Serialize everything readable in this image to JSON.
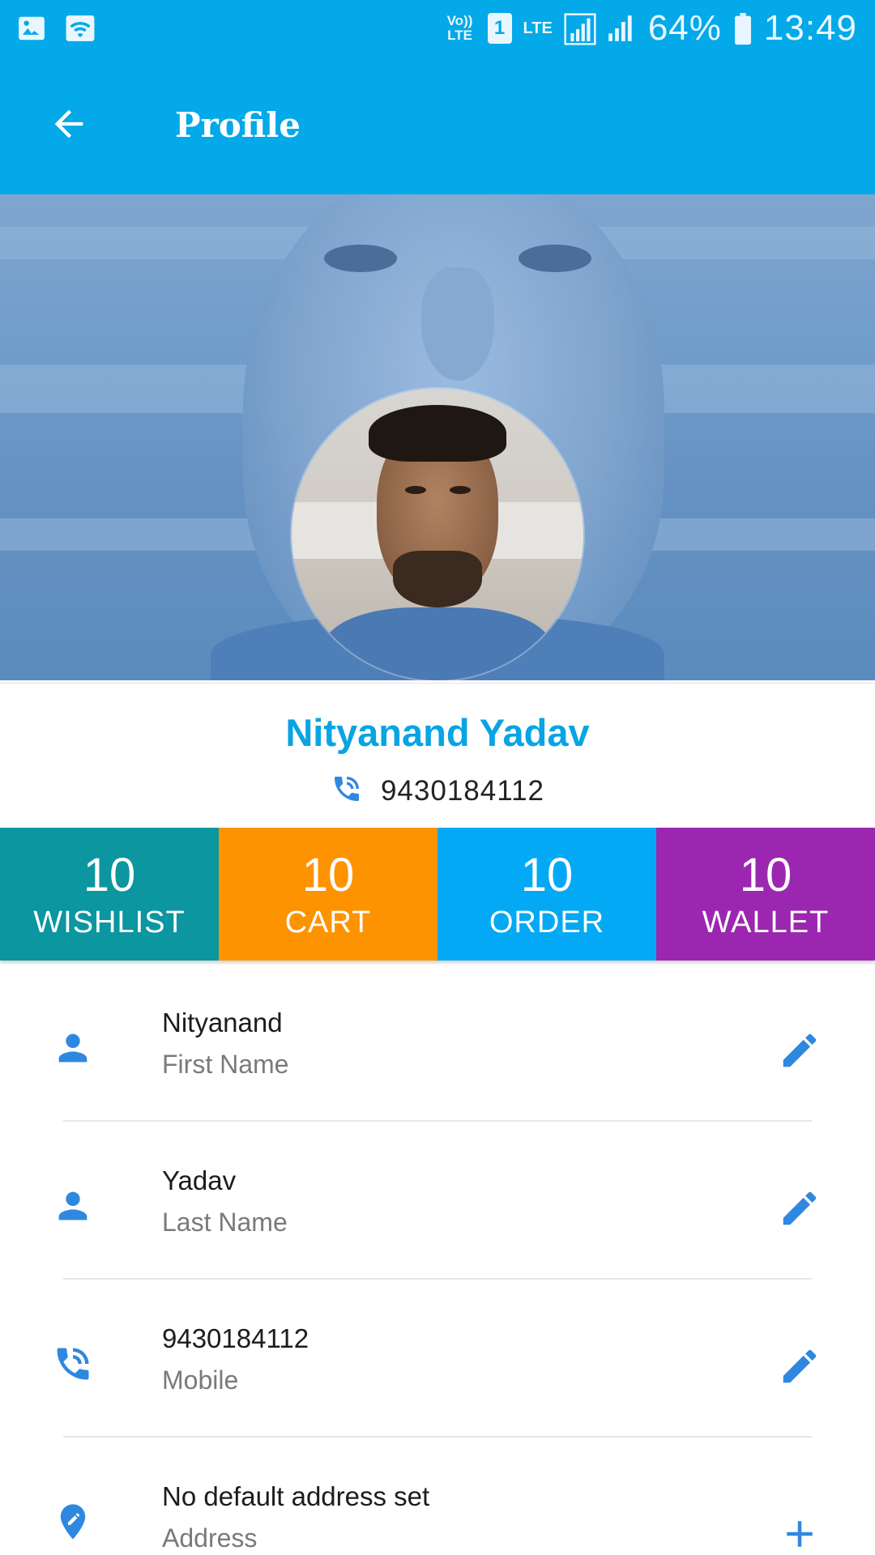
{
  "status_bar": {
    "volte": "Vo)) LTE",
    "sim": "1",
    "network": "LTE",
    "battery": "64%",
    "time": "13:49"
  },
  "app_bar": {
    "title": "Profile"
  },
  "profile": {
    "name": "Nityanand Yadav",
    "phone": "9430184112"
  },
  "stats": [
    {
      "value": "10",
      "label": "WISHLIST",
      "color": "#0b96a0"
    },
    {
      "value": "10",
      "label": "CART",
      "color": "#fd9300"
    },
    {
      "value": "10",
      "label": "ORDER",
      "color": "#03a9f4"
    },
    {
      "value": "10",
      "label": "WALLET",
      "color": "#9b27b0"
    }
  ],
  "fields": [
    {
      "value": "Nityanand",
      "label": "First Name",
      "icon": "person-icon",
      "action": "edit-icon"
    },
    {
      "value": "Yadav",
      "label": "Last Name",
      "icon": "person-icon",
      "action": "edit-icon"
    },
    {
      "value": "9430184112",
      "label": "Mobile",
      "icon": "phone-icon",
      "action": "edit-icon"
    },
    {
      "value": "No default address set",
      "label": "Address",
      "icon": "location-pin-icon",
      "action": "add-icon"
    }
  ],
  "colors": {
    "primary": "#03a9e8",
    "accent_blue": "#2e88e0",
    "name_color": "#08a4e4"
  }
}
